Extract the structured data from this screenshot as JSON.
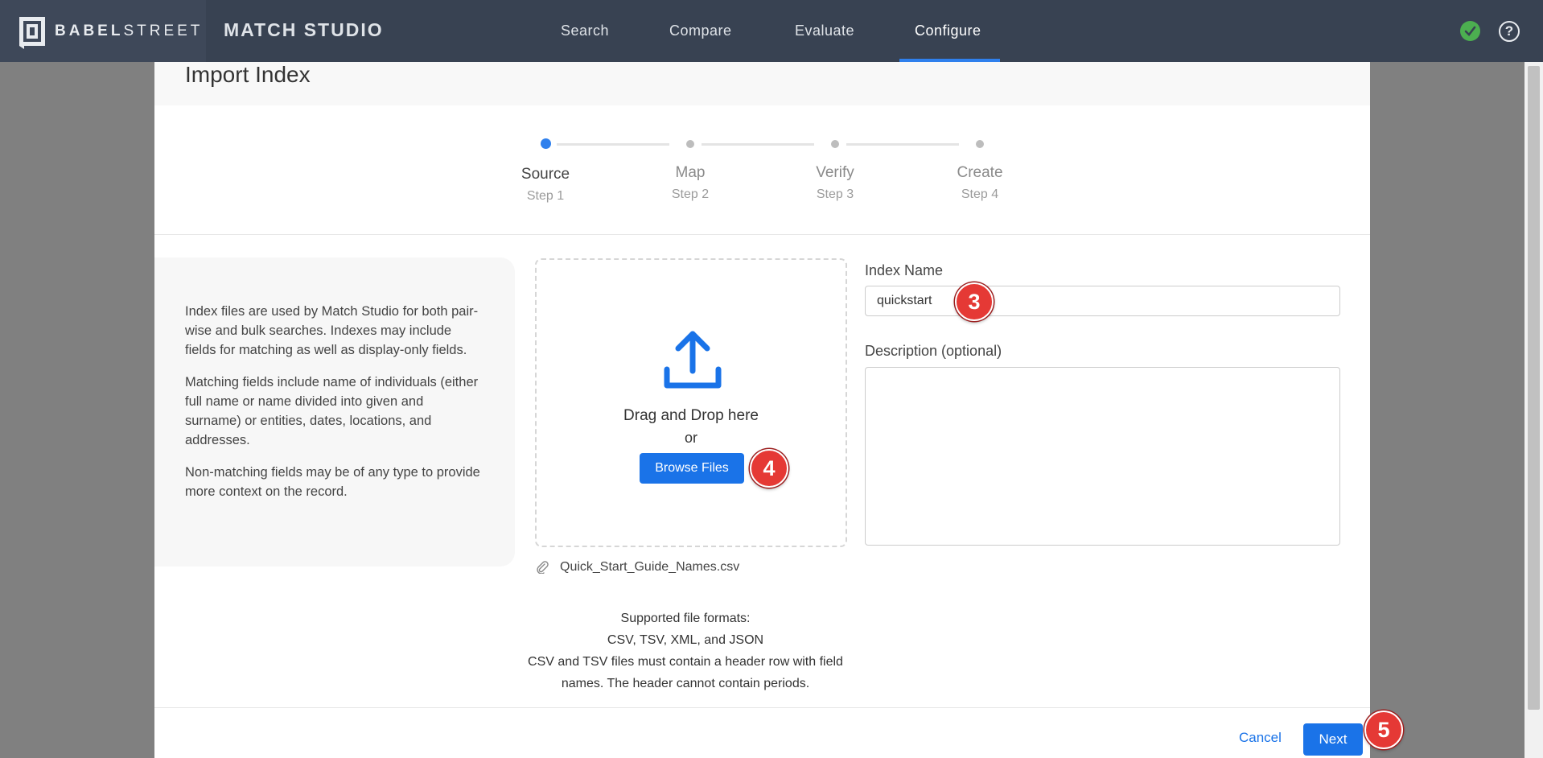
{
  "brand": {
    "logo_bold": "BABEL",
    "logo_light": "STREET",
    "app_title": "MATCH STUDIO"
  },
  "nav": {
    "items": [
      "Search",
      "Compare",
      "Evaluate",
      "Configure"
    ],
    "active": "Configure"
  },
  "modal": {
    "title": "Import Index"
  },
  "steps": [
    {
      "label": "Source",
      "sub": "Step 1",
      "active": true
    },
    {
      "label": "Map",
      "sub": "Step 2",
      "active": false
    },
    {
      "label": "Verify",
      "sub": "Step 3",
      "active": false
    },
    {
      "label": "Create",
      "sub": "Step 4",
      "active": false
    }
  ],
  "info": {
    "p1": "Index files are used by Match Studio for both pair-wise and bulk searches. Indexes may include fields for matching as well as display-only fields.",
    "p2": "Matching fields include name of individuals (either full name or name divided into given and surname) or entities, dates, locations, and addresses.",
    "p3": "Non-matching fields may be of any type to provide more context on the record."
  },
  "dropzone": {
    "drag_text": "Drag and Drop here",
    "or_text": "or",
    "browse_label": "Browse Files",
    "icon": "upload-icon"
  },
  "file": {
    "name": "Quick_Start_Guide_Names.csv",
    "icon": "paperclip-icon"
  },
  "formats": {
    "line1": "Supported file formats:",
    "line2": "CSV, TSV, XML, and JSON",
    "line3": "CSV and TSV files must contain a header row with field names. The header cannot contain periods."
  },
  "form": {
    "index_name_label": "Index Name",
    "index_name_value": "quickstart",
    "description_label": "Description (optional)",
    "description_value": ""
  },
  "footer": {
    "cancel_label": "Cancel",
    "next_label": "Next"
  },
  "badges": {
    "b3": "3",
    "b4": "4",
    "b5": "5"
  },
  "colors": {
    "accent": "#1a73e8",
    "nav_bg": "#384252",
    "badge": "#e53935",
    "status": "#4caf50"
  }
}
